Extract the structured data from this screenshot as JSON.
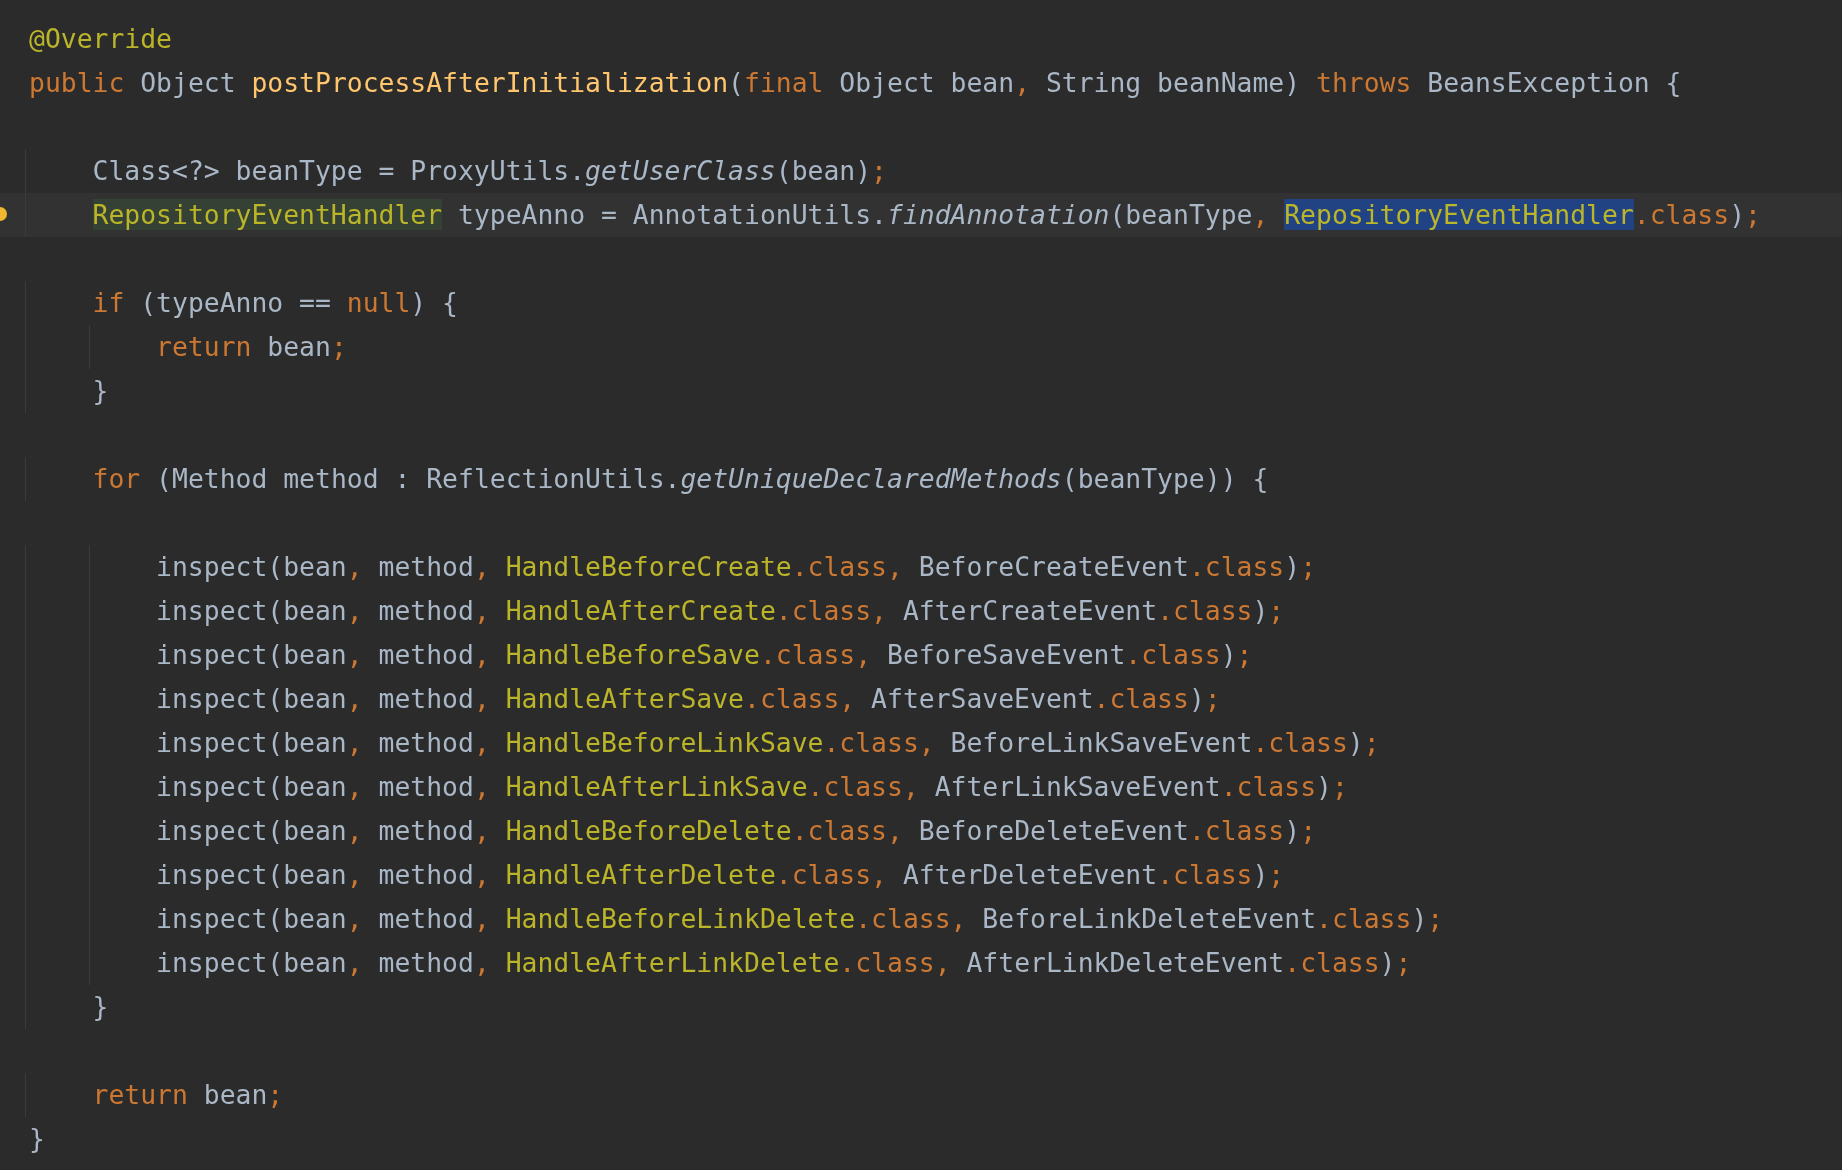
{
  "editor": {
    "lines": [
      {
        "kind": "code",
        "current": false,
        "tokens": [
          {
            "text": "@Override",
            "kind": "annotation"
          }
        ]
      },
      {
        "kind": "code",
        "current": false,
        "tokens": [
          {
            "text": "public",
            "kind": "keyword"
          },
          {
            "text": " Object ",
            "kind": "plain"
          },
          {
            "text": "postProcessAfterInitialization",
            "kind": "method-decl"
          },
          {
            "text": "(",
            "kind": "plain"
          },
          {
            "text": "final",
            "kind": "keyword"
          },
          {
            "text": " Object bean",
            "kind": "plain"
          },
          {
            "text": ",",
            "kind": "keyword"
          },
          {
            "text": " String beanName) ",
            "kind": "plain"
          },
          {
            "text": "throws",
            "kind": "keyword"
          },
          {
            "text": " BeansException {",
            "kind": "plain"
          }
        ]
      },
      {
        "kind": "blank",
        "current": false
      },
      {
        "kind": "code",
        "current": false,
        "tokens": [
          {
            "text": "    Class<?> beanType = ProxyUtils.",
            "kind": "plain"
          },
          {
            "text": "getUserClass",
            "kind": "italic"
          },
          {
            "text": "(bean)",
            "kind": "plain"
          },
          {
            "text": ";",
            "kind": "keyword"
          }
        ]
      },
      {
        "kind": "code",
        "current": true,
        "tokens": [
          {
            "text": "    RepositoryEventHandler",
            "kind": "usage"
          },
          {
            "text": " typeAnno = AnnotationUtils.",
            "kind": "plain"
          },
          {
            "text": "findAnnotation",
            "kind": "italic"
          },
          {
            "text": "(beanType",
            "kind": "plain"
          },
          {
            "text": ", ",
            "kind": "keyword"
          },
          {
            "text": "RepositoryEventHandler",
            "kind": "selection"
          },
          {
            "text": ".class",
            "kind": "keyword"
          },
          {
            "text": ")",
            "kind": "plain"
          },
          {
            "text": ";",
            "kind": "keyword"
          }
        ]
      },
      {
        "kind": "blank",
        "current": false
      },
      {
        "kind": "code",
        "current": false,
        "tokens": [
          {
            "text": "    if",
            "kind": "keyword"
          },
          {
            "text": " (typeAnno == ",
            "kind": "plain"
          },
          {
            "text": "null",
            "kind": "keyword"
          },
          {
            "text": ") {",
            "kind": "plain"
          }
        ]
      },
      {
        "kind": "code",
        "current": false,
        "tokens": [
          {
            "text": "        return",
            "kind": "keyword"
          },
          {
            "text": " bean",
            "kind": "plain"
          },
          {
            "text": ";",
            "kind": "keyword"
          }
        ]
      },
      {
        "kind": "code",
        "current": false,
        "tokens": [
          {
            "text": "    }",
            "kind": "plain"
          }
        ]
      },
      {
        "kind": "blank",
        "current": false
      },
      {
        "kind": "code",
        "current": false,
        "tokens": [
          {
            "text": "    for",
            "kind": "keyword"
          },
          {
            "text": " (Method method : ReflectionUtils.",
            "kind": "plain"
          },
          {
            "text": "getUniqueDeclaredMethods",
            "kind": "italic"
          },
          {
            "text": "(beanType)) {",
            "kind": "plain"
          }
        ]
      },
      {
        "kind": "blank",
        "current": false
      },
      {
        "kind": "code",
        "current": false,
        "tokens": [
          {
            "text": "        inspect(bean",
            "kind": "plain"
          },
          {
            "text": ",",
            "kind": "keyword"
          },
          {
            "text": " method",
            "kind": "plain"
          },
          {
            "text": ", ",
            "kind": "keyword"
          },
          {
            "text": "HandleBeforeCreate",
            "kind": "anno-class"
          },
          {
            "text": ".class,",
            "kind": "keyword"
          },
          {
            "text": " BeforeCreateEvent",
            "kind": "plain"
          },
          {
            "text": ".class",
            "kind": "keyword"
          },
          {
            "text": ")",
            "kind": "plain"
          },
          {
            "text": ";",
            "kind": "keyword"
          }
        ]
      },
      {
        "kind": "code",
        "current": false,
        "tokens": [
          {
            "text": "        inspect(bean",
            "kind": "plain"
          },
          {
            "text": ",",
            "kind": "keyword"
          },
          {
            "text": " method",
            "kind": "plain"
          },
          {
            "text": ", ",
            "kind": "keyword"
          },
          {
            "text": "HandleAfterCreate",
            "kind": "anno-class"
          },
          {
            "text": ".class,",
            "kind": "keyword"
          },
          {
            "text": " AfterCreateEvent",
            "kind": "plain"
          },
          {
            "text": ".class",
            "kind": "keyword"
          },
          {
            "text": ")",
            "kind": "plain"
          },
          {
            "text": ";",
            "kind": "keyword"
          }
        ]
      },
      {
        "kind": "code",
        "current": false,
        "tokens": [
          {
            "text": "        inspect(bean",
            "kind": "plain"
          },
          {
            "text": ",",
            "kind": "keyword"
          },
          {
            "text": " method",
            "kind": "plain"
          },
          {
            "text": ", ",
            "kind": "keyword"
          },
          {
            "text": "HandleBeforeSave",
            "kind": "anno-class"
          },
          {
            "text": ".class,",
            "kind": "keyword"
          },
          {
            "text": " BeforeSaveEvent",
            "kind": "plain"
          },
          {
            "text": ".class",
            "kind": "keyword"
          },
          {
            "text": ")",
            "kind": "plain"
          },
          {
            "text": ";",
            "kind": "keyword"
          }
        ]
      },
      {
        "kind": "code",
        "current": false,
        "tokens": [
          {
            "text": "        inspect(bean",
            "kind": "plain"
          },
          {
            "text": ",",
            "kind": "keyword"
          },
          {
            "text": " method",
            "kind": "plain"
          },
          {
            "text": ", ",
            "kind": "keyword"
          },
          {
            "text": "HandleAfterSave",
            "kind": "anno-class"
          },
          {
            "text": ".class,",
            "kind": "keyword"
          },
          {
            "text": " AfterSaveEvent",
            "kind": "plain"
          },
          {
            "text": ".class",
            "kind": "keyword"
          },
          {
            "text": ")",
            "kind": "plain"
          },
          {
            "text": ";",
            "kind": "keyword"
          }
        ]
      },
      {
        "kind": "code",
        "current": false,
        "tokens": [
          {
            "text": "        inspect(bean",
            "kind": "plain"
          },
          {
            "text": ",",
            "kind": "keyword"
          },
          {
            "text": " method",
            "kind": "plain"
          },
          {
            "text": ", ",
            "kind": "keyword"
          },
          {
            "text": "HandleBeforeLinkSave",
            "kind": "anno-class"
          },
          {
            "text": ".class,",
            "kind": "keyword"
          },
          {
            "text": " BeforeLinkSaveEvent",
            "kind": "plain"
          },
          {
            "text": ".class",
            "kind": "keyword"
          },
          {
            "text": ")",
            "kind": "plain"
          },
          {
            "text": ";",
            "kind": "keyword"
          }
        ]
      },
      {
        "kind": "code",
        "current": false,
        "tokens": [
          {
            "text": "        inspect(bean",
            "kind": "plain"
          },
          {
            "text": ",",
            "kind": "keyword"
          },
          {
            "text": " method",
            "kind": "plain"
          },
          {
            "text": ", ",
            "kind": "keyword"
          },
          {
            "text": "HandleAfterLinkSave",
            "kind": "anno-class"
          },
          {
            "text": ".class,",
            "kind": "keyword"
          },
          {
            "text": " AfterLinkSaveEvent",
            "kind": "plain"
          },
          {
            "text": ".class",
            "kind": "keyword"
          },
          {
            "text": ")",
            "kind": "plain"
          },
          {
            "text": ";",
            "kind": "keyword"
          }
        ]
      },
      {
        "kind": "code",
        "current": false,
        "tokens": [
          {
            "text": "        inspect(bean",
            "kind": "plain"
          },
          {
            "text": ",",
            "kind": "keyword"
          },
          {
            "text": " method",
            "kind": "plain"
          },
          {
            "text": ", ",
            "kind": "keyword"
          },
          {
            "text": "HandleBeforeDelete",
            "kind": "anno-class"
          },
          {
            "text": ".class,",
            "kind": "keyword"
          },
          {
            "text": " BeforeDeleteEvent",
            "kind": "plain"
          },
          {
            "text": ".class",
            "kind": "keyword"
          },
          {
            "text": ")",
            "kind": "plain"
          },
          {
            "text": ";",
            "kind": "keyword"
          }
        ]
      },
      {
        "kind": "code",
        "current": false,
        "tokens": [
          {
            "text": "        inspect(bean",
            "kind": "plain"
          },
          {
            "text": ",",
            "kind": "keyword"
          },
          {
            "text": " method",
            "kind": "plain"
          },
          {
            "text": ", ",
            "kind": "keyword"
          },
          {
            "text": "HandleAfterDelete",
            "kind": "anno-class"
          },
          {
            "text": ".class,",
            "kind": "keyword"
          },
          {
            "text": " AfterDeleteEvent",
            "kind": "plain"
          },
          {
            "text": ".class",
            "kind": "keyword"
          },
          {
            "text": ")",
            "kind": "plain"
          },
          {
            "text": ";",
            "kind": "keyword"
          }
        ]
      },
      {
        "kind": "code",
        "current": false,
        "tokens": [
          {
            "text": "        inspect(bean",
            "kind": "plain"
          },
          {
            "text": ",",
            "kind": "keyword"
          },
          {
            "text": " method",
            "kind": "plain"
          },
          {
            "text": ", ",
            "kind": "keyword"
          },
          {
            "text": "HandleBeforeLinkDelete",
            "kind": "anno-class"
          },
          {
            "text": ".class,",
            "kind": "keyword"
          },
          {
            "text": " BeforeLinkDeleteEvent",
            "kind": "plain"
          },
          {
            "text": ".class",
            "kind": "keyword"
          },
          {
            "text": ")",
            "kind": "plain"
          },
          {
            "text": ";",
            "kind": "keyword"
          }
        ]
      },
      {
        "kind": "code",
        "current": false,
        "tokens": [
          {
            "text": "        inspect(bean",
            "kind": "plain"
          },
          {
            "text": ",",
            "kind": "keyword"
          },
          {
            "text": " method",
            "kind": "plain"
          },
          {
            "text": ", ",
            "kind": "keyword"
          },
          {
            "text": "HandleAfterLinkDelete",
            "kind": "anno-class"
          },
          {
            "text": ".class,",
            "kind": "keyword"
          },
          {
            "text": " AfterLinkDeleteEvent",
            "kind": "plain"
          },
          {
            "text": ".class",
            "kind": "keyword"
          },
          {
            "text": ")",
            "kind": "plain"
          },
          {
            "text": ";",
            "kind": "keyword"
          }
        ]
      },
      {
        "kind": "code",
        "current": false,
        "tokens": [
          {
            "text": "    }",
            "kind": "plain"
          }
        ]
      },
      {
        "kind": "blank",
        "current": false
      },
      {
        "kind": "code",
        "current": false,
        "tokens": [
          {
            "text": "    return",
            "kind": "keyword"
          },
          {
            "text": " bean",
            "kind": "plain"
          },
          {
            "text": ";",
            "kind": "keyword"
          }
        ]
      },
      {
        "kind": "code",
        "current": false,
        "tokens": [
          {
            "text": "}",
            "kind": "plain"
          }
        ]
      }
    ]
  }
}
